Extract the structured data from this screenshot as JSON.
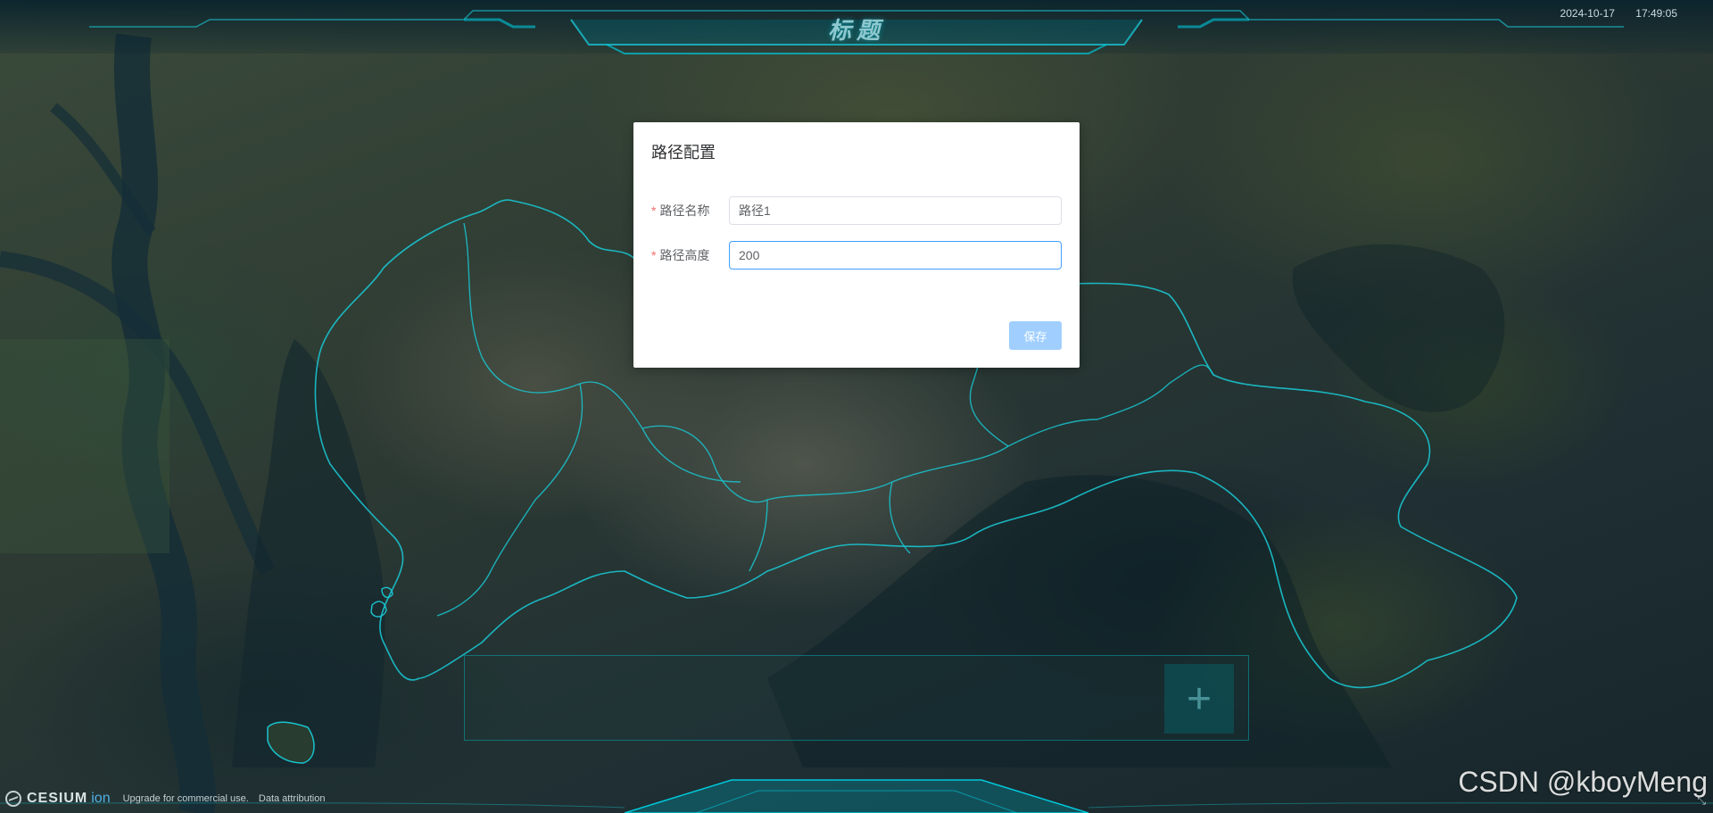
{
  "header": {
    "title": "标题",
    "date": "2024-10-17",
    "time": "17:49:05"
  },
  "dialog": {
    "title": "路径配置",
    "fields": [
      {
        "label": "路径名称",
        "required": true,
        "value": "路径1"
      },
      {
        "label": "路径高度",
        "required": true,
        "value": "200"
      }
    ],
    "save_label": "保存"
  },
  "bottom_panel": {
    "add_icon": "plus-icon",
    "add_symbol": "+"
  },
  "cesium_credit": {
    "brand": "CESIUM",
    "brand_suffix": "ion",
    "upgrade_text": "Upgrade for commercial use.",
    "attribution_text": "Data attribution"
  },
  "watermark": "CSDN @kboyMeng",
  "colors": {
    "accent": "#409eff",
    "required": "#f56c6c",
    "save_button_bg": "#a0cfff",
    "boundary_line": "#19c4cf",
    "header_glow": "#00c8dc"
  },
  "icons": {
    "corner": "fullscreen-icon"
  }
}
